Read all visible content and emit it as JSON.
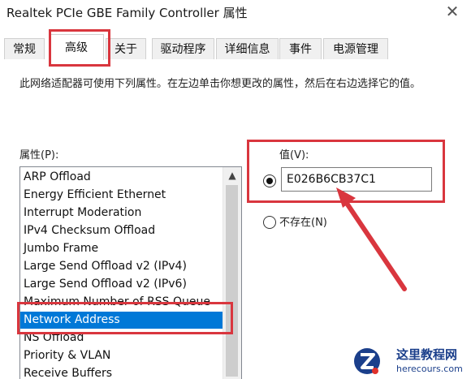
{
  "window": {
    "title": "Realtek PCIe GBE Family Controller 属性"
  },
  "tabs": [
    {
      "label": "常规"
    },
    {
      "label": "高级",
      "active": true
    },
    {
      "label": "关于"
    },
    {
      "label": "驱动程序"
    },
    {
      "label": "详细信息"
    },
    {
      "label": "事件"
    },
    {
      "label": "电源管理"
    }
  ],
  "description": "此网络适配器可使用下列属性。在左边单击你想更改的属性，然后在右边选择它的值。",
  "properties": {
    "label": "属性(P):",
    "items": [
      "ARP Offload",
      "Energy Efficient Ethernet",
      "Interrupt Moderation",
      "IPv4 Checksum Offload",
      "Jumbo Frame",
      "Large Send Offload v2 (IPv4)",
      "Large Send Offload v2 (IPv6)",
      "Maximum Number of RSS Queue",
      "Network Address",
      "NS Offload",
      "Priority & VLAN",
      "Receive Buffers"
    ],
    "selected": "Network Address"
  },
  "value": {
    "label": "值(V):",
    "input_value": "E026B6CB37C1",
    "not_present_label": "不存在(N)",
    "selected_option": "value"
  },
  "colors": {
    "highlight": "#d9363e",
    "selection": "#0078d7",
    "watermark": "#1b3f8b"
  },
  "watermark": {
    "name": "这里教程网",
    "url": "herecours.com"
  }
}
